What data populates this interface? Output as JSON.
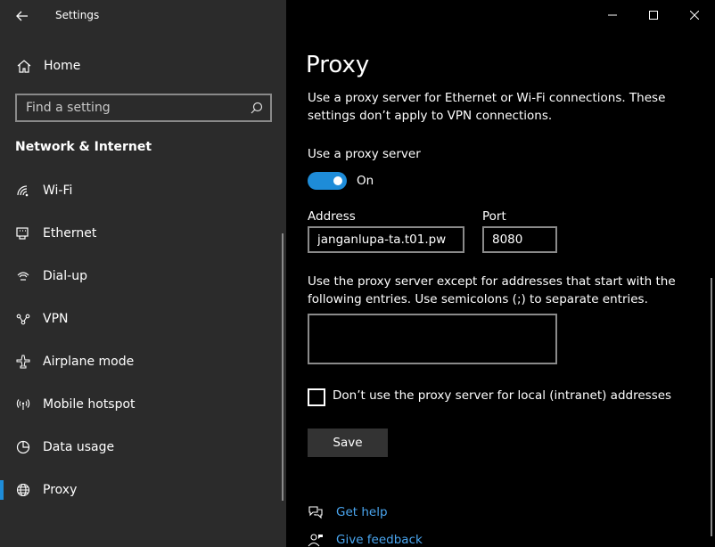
{
  "app": {
    "title": "Settings"
  },
  "sidebar": {
    "home_label": "Home",
    "search_placeholder": "Find a setting",
    "section_title": "Network & Internet",
    "items": [
      {
        "label": "Wi-Fi",
        "icon": "wifi-icon"
      },
      {
        "label": "Ethernet",
        "icon": "ethernet-icon"
      },
      {
        "label": "Dial-up",
        "icon": "dialup-icon"
      },
      {
        "label": "VPN",
        "icon": "vpn-icon"
      },
      {
        "label": "Airplane mode",
        "icon": "airplane-icon"
      },
      {
        "label": "Mobile hotspot",
        "icon": "hotspot-icon"
      },
      {
        "label": "Data usage",
        "icon": "data-usage-icon"
      },
      {
        "label": "Proxy",
        "icon": "globe-icon",
        "active": true
      }
    ]
  },
  "main": {
    "title": "Proxy",
    "description": "Use a proxy server for Ethernet or Wi-Fi connections. These settings don’t apply to VPN connections.",
    "use_proxy_label": "Use a proxy server",
    "toggle_state": "On",
    "address_label": "Address",
    "address_value": "janganlupa-ta.t01.pw",
    "port_label": "Port",
    "port_value": "8080",
    "exceptions_description": "Use the proxy server except for addresses that start with the following entries. Use semicolons (;) to separate entries.",
    "exceptions_value": "",
    "local_checkbox_label": "Don’t use the proxy server for local (intranet) addresses",
    "save_label": "Save",
    "help_links": {
      "get_help": "Get help",
      "give_feedback": "Give feedback"
    }
  },
  "colors": {
    "accent": "#1e8cd8",
    "link": "#4aa6f0",
    "sidebar_bg": "#2b2b2b",
    "main_bg": "#000000"
  }
}
